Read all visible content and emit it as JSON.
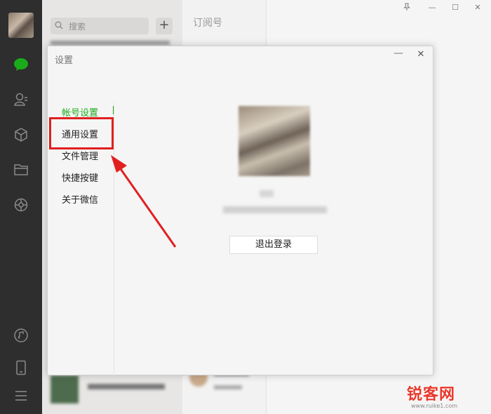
{
  "search": {
    "placeholder": "搜索"
  },
  "chatlist": {
    "add_label": "+"
  },
  "midcol": {
    "title": "订阅号"
  },
  "window_controls": {
    "pin": "✆",
    "minimize": "—",
    "maximize": "☐",
    "close": "✕"
  },
  "dialog": {
    "title": "设置",
    "minimize": "—",
    "close": "✕",
    "nav": [
      {
        "label": "帐号设置",
        "active": true
      },
      {
        "label": "通用设置",
        "active": false
      },
      {
        "label": "文件管理",
        "active": false
      },
      {
        "label": "快捷按键",
        "active": false
      },
      {
        "label": "关于微信",
        "active": false
      }
    ],
    "logout_label": "退出登录"
  },
  "watermark": {
    "brand": "锐客网",
    "url": "www.ruike1.com"
  },
  "colors": {
    "accent_green": "#1aad19",
    "annotation_red": "#e21f1f",
    "sidebar_bg": "#2e2e2e"
  },
  "icons": [
    "chat-icon",
    "contacts-icon",
    "favorites-cube-icon",
    "folder-icon",
    "moments-icon",
    "music-icon",
    "phone-icon",
    "menu-icon"
  ]
}
